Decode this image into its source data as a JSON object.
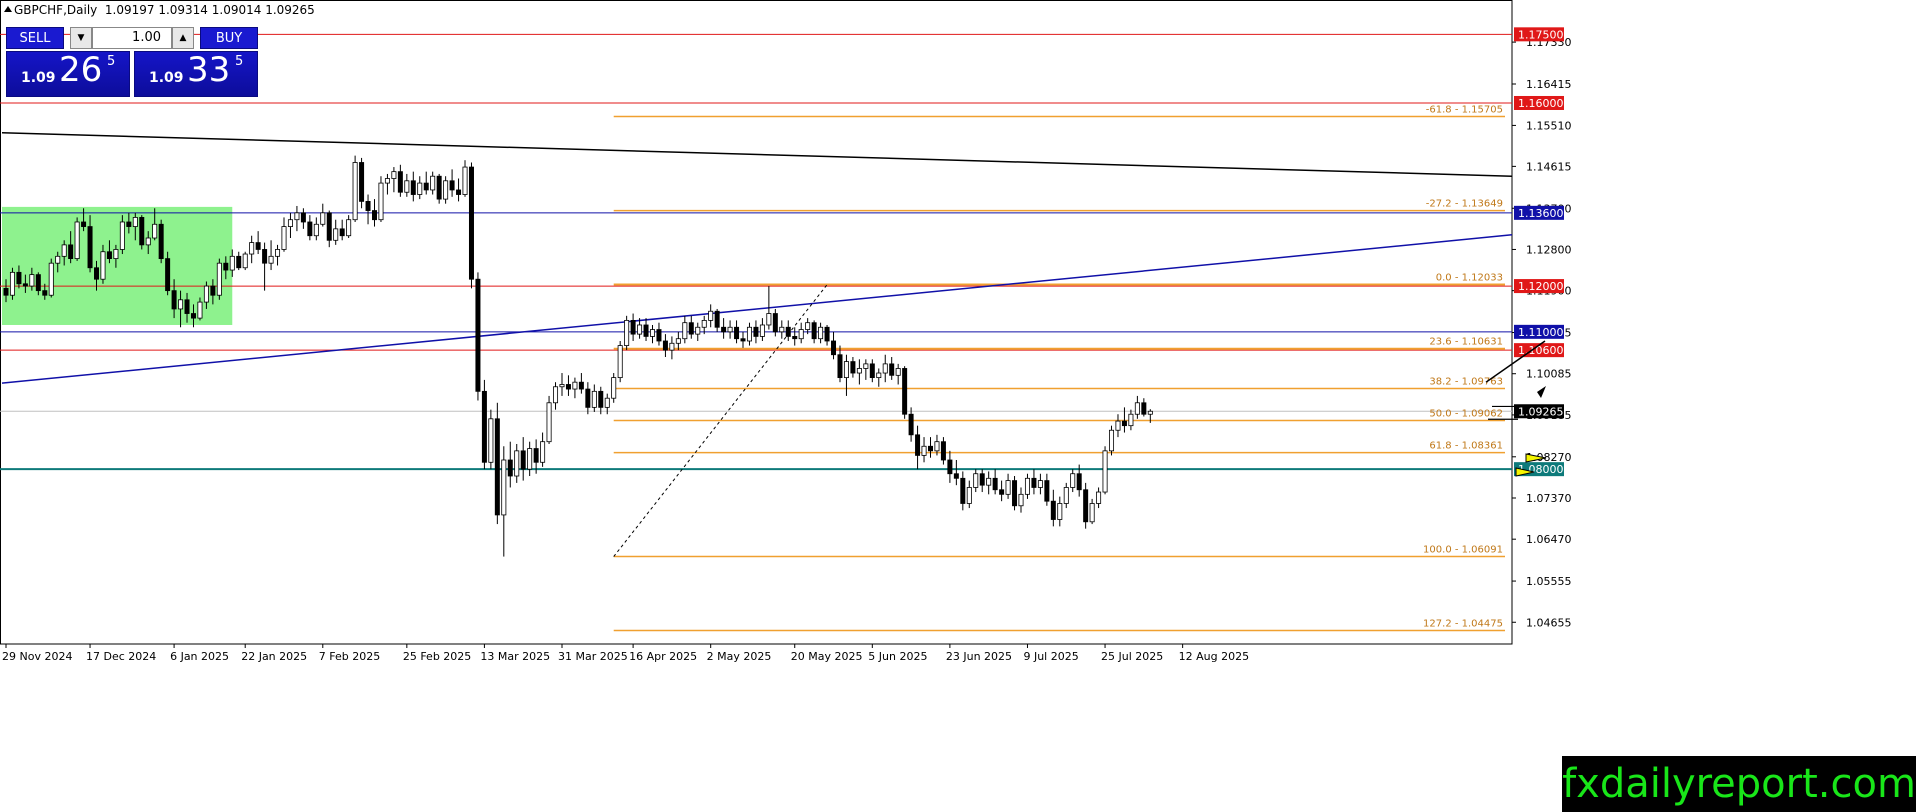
{
  "header": {
    "symbol_info": "GBPCHF,Daily  1.09197 1.09314 1.09014 1.09265"
  },
  "trade_panel": {
    "sell_label": "SELL",
    "buy_label": "BUY",
    "lot": "1.00",
    "sell_prefix": "1.09",
    "sell_big": "26",
    "sell_sup": "5",
    "buy_prefix": "1.09",
    "buy_big": "33",
    "buy_sup": "5"
  },
  "brand": "fxdailyreport.com",
  "chart_data": {
    "type": "candlestick",
    "title": "GBPCHF,Daily",
    "ylim": [
      1.0418,
      1.1825
    ],
    "y_ticks": [
      "1.17330",
      "1.16415",
      "1.15510",
      "1.14615",
      "1.13700",
      "1.12800",
      "1.11900",
      "1.10985",
      "1.10085",
      "1.09185",
      "1.08270",
      "1.07370",
      "1.06470",
      "1.05555",
      "1.04655"
    ],
    "x_tick_labels": [
      {
        "label": "29 Nov 2024",
        "bar": 0
      },
      {
        "label": "17 Dec 2024",
        "bar": 13
      },
      {
        "label": "6 Jan 2025",
        "bar": 26
      },
      {
        "label": "22 Jan 2025",
        "bar": 37
      },
      {
        "label": "7 Feb 2025",
        "bar": 49
      },
      {
        "label": "25 Feb 2025",
        "bar": 62
      },
      {
        "label": "13 Mar 2025",
        "bar": 74
      },
      {
        "label": "31 Mar 2025",
        "bar": 86
      },
      {
        "label": "16 Apr 2025",
        "bar": 97
      },
      {
        "label": "2 May 2025",
        "bar": 109
      },
      {
        "label": "20 May 2025",
        "bar": 122
      },
      {
        "label": "5 Jun 2025",
        "bar": 134
      },
      {
        "label": "23 Jun 2025",
        "bar": 146
      },
      {
        "label": "9 Jul 2025",
        "bar": 158
      },
      {
        "label": "25 Jul 2025",
        "bar": 170
      },
      {
        "label": "12 Aug 2025",
        "bar": 182
      }
    ],
    "candles": [
      [
        1.1195,
        1.1215,
        1.1165,
        1.118
      ],
      [
        1.118,
        1.124,
        1.117,
        1.123
      ],
      [
        1.123,
        1.1245,
        1.1195,
        1.1205
      ],
      [
        1.1205,
        1.1225,
        1.1185,
        1.12
      ],
      [
        1.12,
        1.124,
        1.119,
        1.1225
      ],
      [
        1.1225,
        1.123,
        1.118,
        1.119
      ],
      [
        1.119,
        1.1205,
        1.117,
        1.118
      ],
      [
        1.118,
        1.126,
        1.1175,
        1.125
      ],
      [
        1.125,
        1.1275,
        1.123,
        1.1265
      ],
      [
        1.1265,
        1.13,
        1.1245,
        1.129
      ],
      [
        1.129,
        1.132,
        1.125,
        1.126
      ],
      [
        1.126,
        1.135,
        1.1255,
        1.134
      ],
      [
        1.134,
        1.137,
        1.132,
        1.133
      ],
      [
        1.133,
        1.1355,
        1.123,
        1.124
      ],
      [
        1.124,
        1.1255,
        1.119,
        1.1215
      ],
      [
        1.1215,
        1.129,
        1.1205,
        1.1275
      ],
      [
        1.1275,
        1.13,
        1.125,
        1.126
      ],
      [
        1.126,
        1.129,
        1.124,
        1.128
      ],
      [
        1.128,
        1.1355,
        1.127,
        1.134
      ],
      [
        1.134,
        1.136,
        1.1315,
        1.133
      ],
      [
        1.133,
        1.136,
        1.13,
        1.135
      ],
      [
        1.135,
        1.1355,
        1.128,
        1.129
      ],
      [
        1.129,
        1.132,
        1.127,
        1.1305
      ],
      [
        1.1305,
        1.137,
        1.13,
        1.1335
      ],
      [
        1.1335,
        1.1345,
        1.125,
        1.126
      ],
      [
        1.126,
        1.1275,
        1.118,
        1.119
      ],
      [
        1.119,
        1.1215,
        1.113,
        1.115
      ],
      [
        1.115,
        1.119,
        1.111,
        1.117
      ],
      [
        1.117,
        1.1185,
        1.112,
        1.114
      ],
      [
        1.114,
        1.116,
        1.111,
        1.113
      ],
      [
        1.113,
        1.1175,
        1.1125,
        1.1165
      ],
      [
        1.1165,
        1.121,
        1.115,
        1.12
      ],
      [
        1.12,
        1.1215,
        1.116,
        1.118
      ],
      [
        1.118,
        1.126,
        1.117,
        1.125
      ],
      [
        1.125,
        1.1265,
        1.1215,
        1.1235
      ],
      [
        1.1235,
        1.128,
        1.122,
        1.1265
      ],
      [
        1.1265,
        1.1275,
        1.1235,
        1.124
      ],
      [
        1.124,
        1.1275,
        1.1235,
        1.127
      ],
      [
        1.127,
        1.131,
        1.125,
        1.1295
      ],
      [
        1.1295,
        1.132,
        1.127,
        1.128
      ],
      [
        1.128,
        1.1295,
        1.119,
        1.125
      ],
      [
        1.125,
        1.13,
        1.1235,
        1.1265
      ],
      [
        1.1265,
        1.129,
        1.1245,
        1.128
      ],
      [
        1.128,
        1.135,
        1.1275,
        1.133
      ],
      [
        1.133,
        1.136,
        1.1305,
        1.1345
      ],
      [
        1.1345,
        1.1375,
        1.132,
        1.136
      ],
      [
        1.136,
        1.137,
        1.1325,
        1.134
      ],
      [
        1.134,
        1.1355,
        1.13,
        1.131
      ],
      [
        1.131,
        1.135,
        1.13,
        1.1335
      ],
      [
        1.1335,
        1.138,
        1.133,
        1.136
      ],
      [
        1.136,
        1.1365,
        1.1285,
        1.13
      ],
      [
        1.13,
        1.1345,
        1.129,
        1.1325
      ],
      [
        1.1325,
        1.1345,
        1.13,
        1.131
      ],
      [
        1.131,
        1.1355,
        1.1305,
        1.1345
      ],
      [
        1.1345,
        1.1485,
        1.134,
        1.147
      ],
      [
        1.147,
        1.148,
        1.137,
        1.1385
      ],
      [
        1.1385,
        1.14,
        1.1335,
        1.1365
      ],
      [
        1.1365,
        1.139,
        1.133,
        1.1345
      ],
      [
        1.1345,
        1.144,
        1.134,
        1.1425
      ],
      [
        1.1425,
        1.1445,
        1.14,
        1.1435
      ],
      [
        1.1435,
        1.146,
        1.1405,
        1.145
      ],
      [
        1.145,
        1.1465,
        1.1395,
        1.1405
      ],
      [
        1.1405,
        1.1445,
        1.1395,
        1.143
      ],
      [
        1.143,
        1.145,
        1.1385,
        1.14
      ],
      [
        1.14,
        1.144,
        1.139,
        1.1425
      ],
      [
        1.1425,
        1.145,
        1.14,
        1.141
      ],
      [
        1.141,
        1.145,
        1.14,
        1.144
      ],
      [
        1.144,
        1.1445,
        1.138,
        1.139
      ],
      [
        1.139,
        1.144,
        1.138,
        1.143
      ],
      [
        1.143,
        1.1455,
        1.1395,
        1.141
      ],
      [
        1.141,
        1.1435,
        1.1385,
        1.14
      ],
      [
        1.14,
        1.1475,
        1.1395,
        1.146
      ],
      [
        1.146,
        1.147,
        1.1195,
        1.1215
      ],
      [
        1.1215,
        1.123,
        1.095,
        1.097
      ],
      [
        1.097,
        1.0995,
        1.08,
        1.0815
      ],
      [
        1.0815,
        1.093,
        1.08,
        1.091
      ],
      [
        1.091,
        1.0945,
        1.068,
        1.07
      ],
      [
        1.07,
        1.085,
        1.0609,
        1.082
      ],
      [
        1.082,
        1.086,
        1.076,
        1.0785
      ],
      [
        1.0785,
        1.0855,
        1.077,
        1.084
      ],
      [
        1.084,
        1.087,
        1.0775,
        1.08
      ],
      [
        1.08,
        1.086,
        1.0785,
        1.0845
      ],
      [
        1.0845,
        1.0865,
        1.079,
        1.0815
      ],
      [
        1.0815,
        1.088,
        1.0805,
        1.086
      ],
      [
        1.086,
        1.096,
        1.0855,
        1.0945
      ],
      [
        1.0945,
        1.099,
        1.093,
        1.098
      ],
      [
        1.098,
        1.101,
        1.096,
        1.0985
      ],
      [
        1.0985,
        1.1005,
        1.096,
        1.0975
      ],
      [
        1.0975,
        1.1,
        1.0955,
        1.099
      ],
      [
        1.099,
        1.101,
        1.0965,
        1.0975
      ],
      [
        1.0975,
        1.099,
        1.092,
        1.0935
      ],
      [
        1.0935,
        1.0985,
        1.0925,
        1.097
      ],
      [
        1.097,
        1.098,
        1.092,
        1.0935
      ],
      [
        1.0935,
        1.0965,
        1.092,
        1.0955
      ],
      [
        1.0955,
        1.101,
        1.0945,
        1.1
      ],
      [
        1.1,
        1.108,
        1.099,
        1.107
      ],
      [
        1.107,
        1.1135,
        1.106,
        1.1125
      ],
      [
        1.1125,
        1.114,
        1.108,
        1.1095
      ],
      [
        1.1095,
        1.113,
        1.1085,
        1.1115
      ],
      [
        1.1115,
        1.113,
        1.108,
        1.109
      ],
      [
        1.109,
        1.1115,
        1.1075,
        1.1105
      ],
      [
        1.1105,
        1.112,
        1.107,
        1.108
      ],
      [
        1.108,
        1.1095,
        1.1045,
        1.106
      ],
      [
        1.106,
        1.109,
        1.104,
        1.1075
      ],
      [
        1.1075,
        1.11,
        1.106,
        1.1085
      ],
      [
        1.1085,
        1.1135,
        1.1075,
        1.112
      ],
      [
        1.112,
        1.1135,
        1.1085,
        1.1095
      ],
      [
        1.1095,
        1.112,
        1.108,
        1.111
      ],
      [
        1.111,
        1.1135,
        1.1095,
        1.1125
      ],
      [
        1.1125,
        1.116,
        1.111,
        1.1145
      ],
      [
        1.1145,
        1.115,
        1.11,
        1.111
      ],
      [
        1.111,
        1.113,
        1.1085,
        1.11
      ],
      [
        1.11,
        1.1125,
        1.1085,
        1.111
      ],
      [
        1.111,
        1.1125,
        1.1075,
        1.1085
      ],
      [
        1.1085,
        1.11,
        1.1065,
        1.108
      ],
      [
        1.108,
        1.112,
        1.107,
        1.111
      ],
      [
        1.111,
        1.1125,
        1.1075,
        1.109
      ],
      [
        1.109,
        1.113,
        1.108,
        1.1115
      ],
      [
        1.1115,
        1.12,
        1.1105,
        1.114
      ],
      [
        1.114,
        1.115,
        1.109,
        1.11
      ],
      [
        1.11,
        1.1125,
        1.1085,
        1.111
      ],
      [
        1.111,
        1.1125,
        1.108,
        1.109
      ],
      [
        1.109,
        1.111,
        1.107,
        1.1085
      ],
      [
        1.1085,
        1.112,
        1.1075,
        1.1105
      ],
      [
        1.1105,
        1.113,
        1.1095,
        1.112
      ],
      [
        1.112,
        1.1125,
        1.1075,
        1.1085
      ],
      [
        1.1085,
        1.112,
        1.1075,
        1.111
      ],
      [
        1.111,
        1.1115,
        1.107,
        1.108
      ],
      [
        1.108,
        1.11,
        1.104,
        1.105
      ],
      [
        1.105,
        1.107,
        1.099,
        1.1
      ],
      [
        1.1,
        1.105,
        1.096,
        1.1035
      ],
      [
        1.1035,
        1.1045,
        1.1,
        1.101
      ],
      [
        1.101,
        1.104,
        1.0985,
        1.102
      ],
      [
        1.102,
        1.104,
        1.0995,
        1.103
      ],
      [
        1.103,
        1.104,
        1.099,
        1.1
      ],
      [
        1.1,
        1.102,
        1.098,
        1.101
      ],
      [
        1.101,
        1.105,
        1.099,
        1.103
      ],
      [
        1.103,
        1.1045,
        1.0995,
        1.1005
      ],
      [
        1.1005,
        1.103,
        1.0985,
        1.102
      ],
      [
        1.102,
        1.1025,
        1.091,
        1.092
      ],
      [
        1.092,
        1.0935,
        1.086,
        1.0875
      ],
      [
        1.0875,
        1.0895,
        1.08,
        1.083
      ],
      [
        1.083,
        1.087,
        1.0815,
        1.085
      ],
      [
        1.085,
        1.087,
        1.0825,
        1.084
      ],
      [
        1.084,
        1.0875,
        1.083,
        1.086
      ],
      [
        1.086,
        1.087,
        1.081,
        1.082
      ],
      [
        1.082,
        1.084,
        1.077,
        1.079
      ],
      [
        1.079,
        1.082,
        1.0765,
        1.078
      ],
      [
        1.078,
        1.0795,
        1.071,
        1.0725
      ],
      [
        1.0725,
        1.0775,
        1.0715,
        1.076
      ],
      [
        1.076,
        1.08,
        1.075,
        1.079
      ],
      [
        1.079,
        1.08,
        1.075,
        1.0765
      ],
      [
        1.0765,
        1.0795,
        1.0745,
        1.078
      ],
      [
        1.078,
        1.08,
        1.0745,
        1.0755
      ],
      [
        1.0755,
        1.0775,
        1.073,
        1.0745
      ],
      [
        1.0745,
        1.079,
        1.0735,
        1.0775
      ],
      [
        1.0775,
        1.0785,
        1.071,
        1.072
      ],
      [
        1.072,
        1.076,
        1.0705,
        1.0745
      ],
      [
        1.0745,
        1.079,
        1.0735,
        1.078
      ],
      [
        1.078,
        1.08,
        1.0745,
        1.076
      ],
      [
        1.076,
        1.079,
        1.0745,
        1.0775
      ],
      [
        1.0775,
        1.079,
        1.072,
        1.073
      ],
      [
        1.073,
        1.0755,
        1.0675,
        1.069
      ],
      [
        1.069,
        1.074,
        1.0675,
        1.0725
      ],
      [
        1.0725,
        1.077,
        1.0715,
        1.076
      ],
      [
        1.076,
        1.08,
        1.075,
        1.079
      ],
      [
        1.079,
        1.081,
        1.074,
        1.0755
      ],
      [
        1.0755,
        1.077,
        1.067,
        1.0685
      ],
      [
        1.0685,
        1.0735,
        1.068,
        1.0725
      ],
      [
        1.0725,
        1.076,
        1.0715,
        1.075
      ],
      [
        1.075,
        1.085,
        1.0745,
        1.084
      ],
      [
        1.084,
        1.0895,
        1.083,
        1.0885
      ],
      [
        1.0885,
        1.092,
        1.087,
        1.0905
      ],
      [
        1.0905,
        1.0935,
        1.088,
        1.0895
      ],
      [
        1.0895,
        1.093,
        1.0885,
        1.092
      ],
      [
        1.092,
        1.096,
        1.091,
        1.0945
      ],
      [
        1.0945,
        1.0955,
        1.0915,
        1.092
      ],
      [
        1.092,
        1.0931,
        1.0901,
        1.09265
      ]
    ],
    "levels": [
      {
        "price": 1.175,
        "label": "1.17500",
        "color": "#e01818",
        "kind": "line"
      },
      {
        "price": 1.16,
        "label": "1.16000",
        "color": "#e01818",
        "kind": "line"
      },
      {
        "price": 1.136,
        "label": "1.13600",
        "color": "#1010a8",
        "kind": "line"
      },
      {
        "price": 1.12,
        "label": "1.12000",
        "color": "#e01818",
        "kind": "line"
      },
      {
        "price": 1.11,
        "label": "1.11000",
        "color": "#1010a8",
        "kind": "line"
      },
      {
        "price": 1.106,
        "label": "1.10600",
        "color": "#e01818",
        "kind": "line"
      },
      {
        "price": 1.08,
        "label": "1.08000",
        "color": "#0d7a7a",
        "kind": "line"
      },
      {
        "price": 1.09265,
        "label": "1.09265",
        "color": "#000000",
        "kind": "current"
      }
    ],
    "fibonacci": [
      {
        "label": "-61.8 - 1.15705",
        "price": 1.15705
      },
      {
        "label": "-27.2 - 1.13649",
        "price": 1.13649
      },
      {
        "label": "0.0 - 1.12033",
        "price": 1.12033
      },
      {
        "label": "23.6 - 1.10631",
        "price": 1.10631
      },
      {
        "label": "38.2 - 1.09763",
        "price": 1.09763
      },
      {
        "label": "50.0 - 1.09062",
        "price": 1.09062
      },
      {
        "label": "61.8 - 1.08361",
        "price": 1.08361
      },
      {
        "label": "100.0 - 1.06091",
        "price": 1.06091
      },
      {
        "label": "127.2 - 1.04475",
        "price": 1.04475
      }
    ],
    "colors": {
      "fib": "#f0a030",
      "bull_body": "#ffffff",
      "bear_body": "#000000",
      "zone": "#8ef28e",
      "arrow_fill": "#f5f500"
    }
  }
}
